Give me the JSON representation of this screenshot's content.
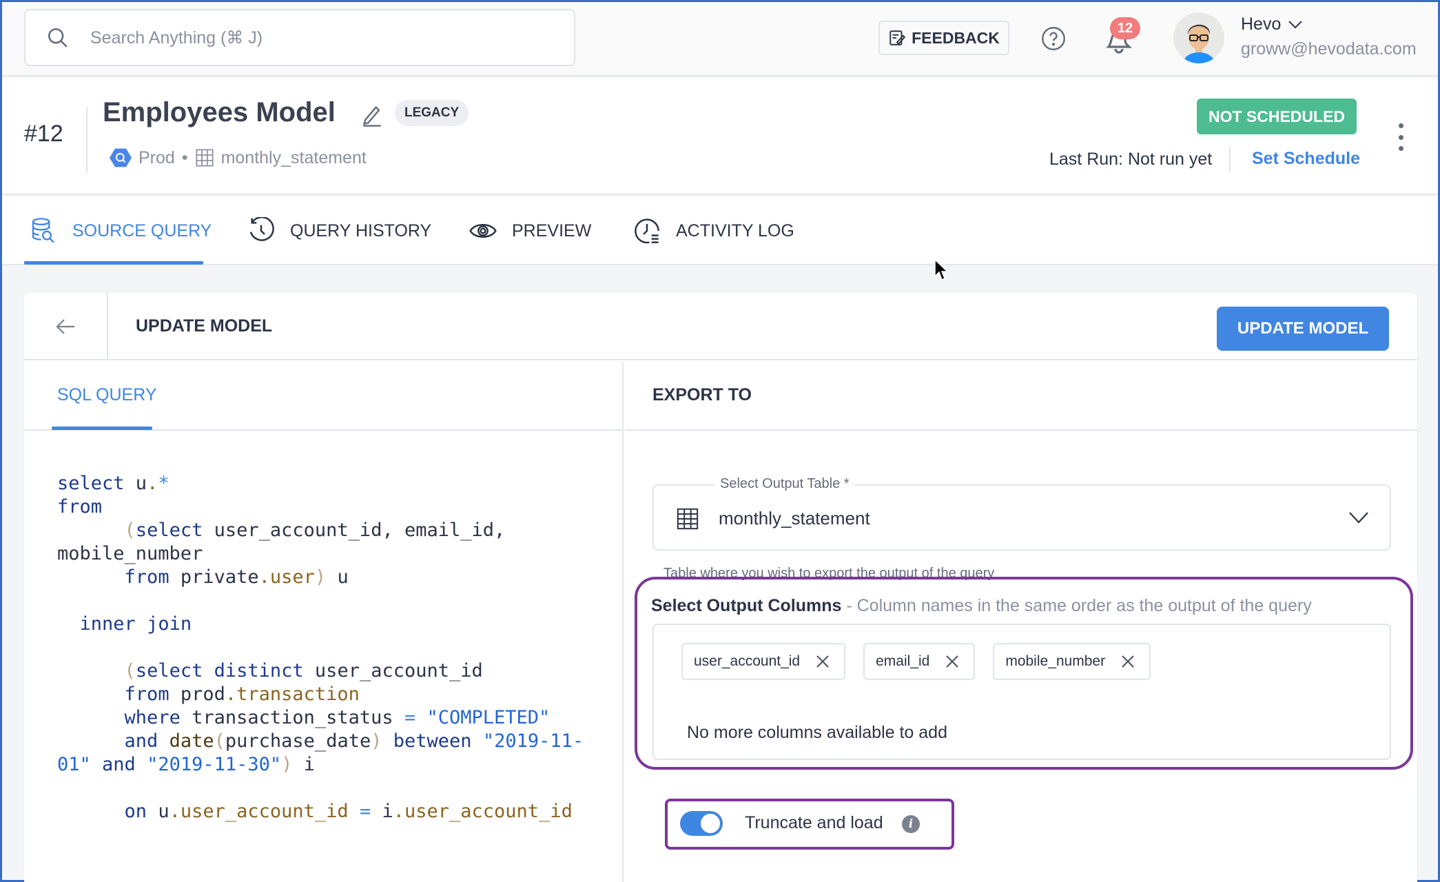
{
  "topbar": {
    "search_placeholder": "Search Anything  (⌘ J)",
    "feedback_label": "FEEDBACK",
    "notification_count": "12",
    "user_name": "Hevo",
    "user_email": "groww@hevodata.com"
  },
  "model": {
    "number": "#12",
    "title": "Employees Model",
    "tag": "LEGACY",
    "source": "Prod",
    "separator": "•",
    "table": "monthly_statement",
    "status": "NOT SCHEDULED",
    "last_run": "Last Run: Not run yet",
    "set_schedule": "Set Schedule"
  },
  "tabs": [
    {
      "label": "SOURCE QUERY",
      "icon": "database-search-icon",
      "active": true
    },
    {
      "label": "QUERY HISTORY",
      "icon": "history-icon",
      "active": false
    },
    {
      "label": "PREVIEW",
      "icon": "eye-icon",
      "active": false
    },
    {
      "label": "ACTIVITY LOG",
      "icon": "clock-list-icon",
      "active": false
    }
  ],
  "card": {
    "title": "UPDATE MODEL",
    "update_button": "UPDATE MODEL",
    "sql_tab": "SQL QUERY",
    "export_title": "EXPORT TO"
  },
  "sql": {
    "lines": [
      "select u.*",
      "from",
      "      (select user_account_id, email_id,",
      "mobile_number",
      "      from private.user) u",
      "",
      "  inner join",
      "",
      "      (select distinct user_account_id",
      "      from prod.transaction",
      "      where transaction_status = \"COMPLETED\"",
      "      and date(purchase_date) between \"2019-11-",
      "01\" and \"2019-11-30\") i",
      "",
      "      on u.user_account_id = i.user_account_id"
    ]
  },
  "export": {
    "output_table_label": "Select Output Table *",
    "output_table_value": "monthly_statement",
    "output_table_helper": "Table where you wish to export the output of the query",
    "columns_label": "Select Output Columns",
    "columns_hint": " - Column names in the same order as the output of the query",
    "columns": [
      "user_account_id",
      "email_id",
      "mobile_number"
    ],
    "no_more": "No more columns available to add",
    "truncate_label": "Truncate and load",
    "truncate_enabled": true,
    "info_glyph": "i"
  }
}
